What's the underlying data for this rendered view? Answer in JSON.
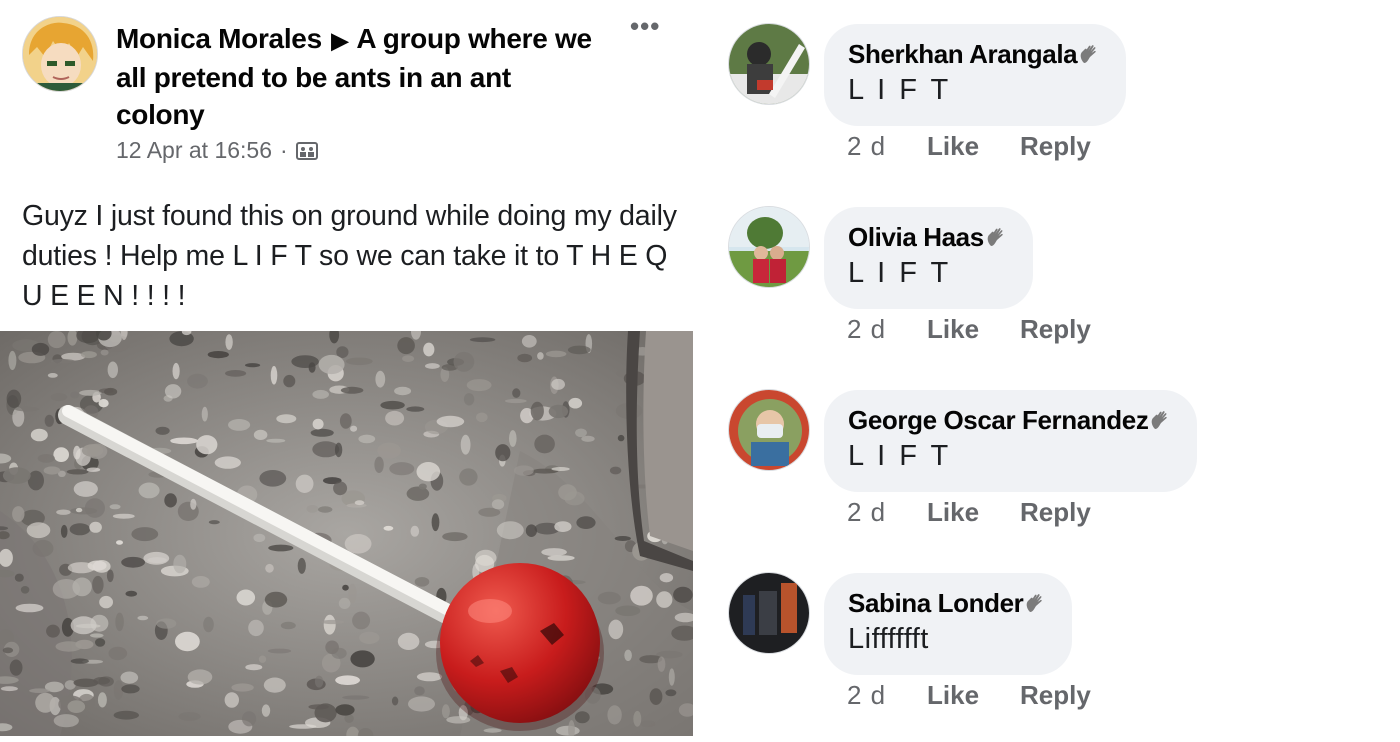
{
  "post": {
    "author": "Monica Morales",
    "group": "A group where we all pretend to be ants in an ant colony",
    "timestamp": "12 Apr at 16:56",
    "separator": "·",
    "more_icon": "more-options-icon",
    "privacy_icon": "group-privacy-icon",
    "text": "Guyz I just found this on ground while doing my daily duties ! Help me L I F T so we can take it to T H E   Q U E E N ! ! ! !",
    "photo_colors": {
      "stick": "#f4f3f0",
      "candy": "#c81c1c",
      "gravel": "#8f8c88"
    }
  },
  "comments": [
    {
      "name": "Sherkhan Arangala",
      "text": "L I F T",
      "time": "2 d",
      "like": "Like",
      "reply": "Reply",
      "badge_icon": "wave-icon"
    },
    {
      "name": "Olivia Haas",
      "text": "L I F T",
      "time": "2 d",
      "like": "Like",
      "reply": "Reply",
      "badge_icon": "wave-icon"
    },
    {
      "name": "George Oscar Fernandez",
      "text": "L I F T",
      "time": "2 d",
      "like": "Like",
      "reply": "Reply",
      "badge_icon": "wave-icon"
    },
    {
      "name": "Sabina Londer",
      "text": "Lifffffft",
      "time": "2 d",
      "like": "Like",
      "reply": "Reply",
      "badge_icon": "wave-icon"
    }
  ],
  "colors": {
    "bubble": "#f0f2f5",
    "secondary_text": "#65676b",
    "primary_text": "#050505"
  }
}
